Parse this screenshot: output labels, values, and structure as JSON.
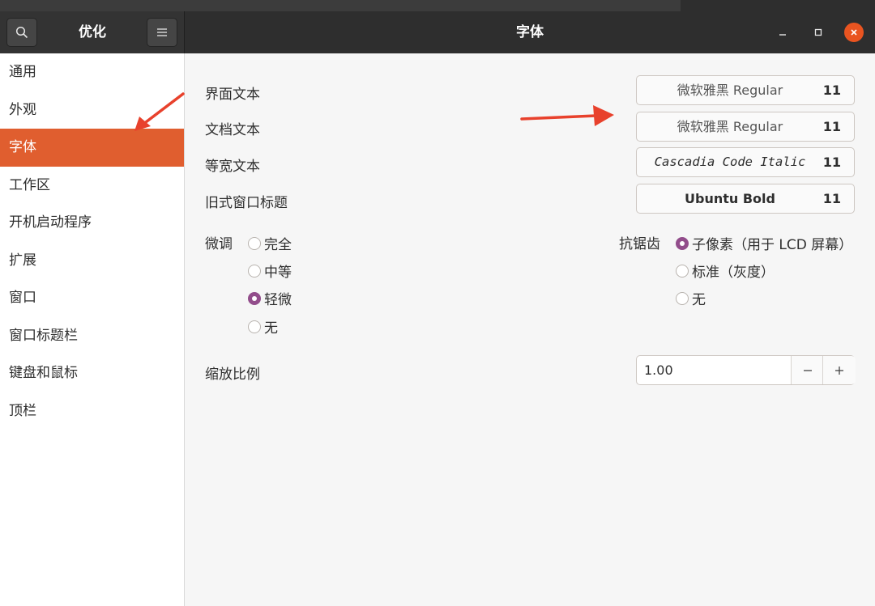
{
  "header": {
    "app_title": "优化",
    "page_title": "字体",
    "close_color": "#e95420"
  },
  "sidebar": {
    "items": [
      {
        "label": "通用"
      },
      {
        "label": "外观"
      },
      {
        "label": "字体",
        "active": true
      },
      {
        "label": "工作区"
      },
      {
        "label": "开机启动程序"
      },
      {
        "label": "扩展"
      },
      {
        "label": "窗口"
      },
      {
        "label": "窗口标题栏"
      },
      {
        "label": "键盘和鼠标"
      },
      {
        "label": "顶栏"
      }
    ],
    "active_color": "#e05e2f"
  },
  "fonts": [
    {
      "label": "界面文本",
      "font": "微软雅黑 Regular",
      "size": "11"
    },
    {
      "label": "文档文本",
      "font": "微软雅黑 Regular",
      "size": "11"
    },
    {
      "label": "等宽文本",
      "font": "Cascadia Code Italic",
      "size": "11"
    },
    {
      "label": "旧式窗口标题",
      "font": "Ubuntu Bold",
      "size": "11"
    }
  ],
  "hinting": {
    "label": "微调",
    "options": [
      "完全",
      "中等",
      "轻微",
      "无"
    ],
    "selected": "轻微"
  },
  "antialiasing": {
    "label": "抗锯齿",
    "options": [
      "子像素（用于 LCD 屏幕）",
      "标准（灰度）",
      "无"
    ],
    "selected": "子像素（用于 LCD 屏幕）"
  },
  "scaling": {
    "label": "缩放比例",
    "value": "1.00"
  },
  "accent_radio_color": "#924d8b",
  "annotation_arrow_color": "#e8412c"
}
